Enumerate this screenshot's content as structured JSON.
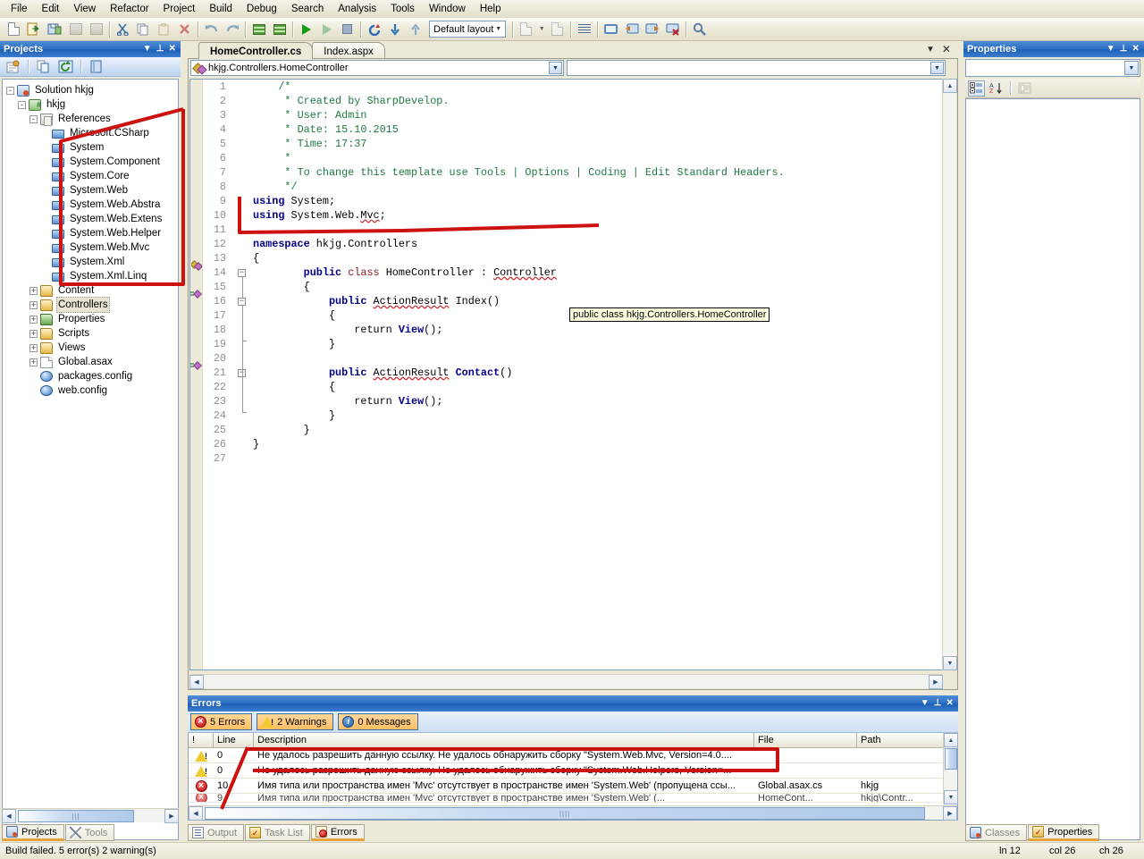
{
  "menu": {
    "items": [
      "File",
      "Edit",
      "View",
      "Refactor",
      "Project",
      "Build",
      "Debug",
      "Search",
      "Analysis",
      "Tools",
      "Window",
      "Help"
    ]
  },
  "toolbar": {
    "layout_label": "Default layout",
    "buttons": [
      "new-file-icon",
      "open-file-icon",
      "save-all-icon",
      "save-icon",
      "save-as-icon",
      "cut-icon",
      "copy-icon",
      "paste-icon",
      "delete-icon",
      "undo-icon",
      "redo-icon",
      "build-icon",
      "rebuild-icon",
      "run-icon",
      "run-debug-icon",
      "stop-icon",
      "refresh-icon",
      "step-down-icon",
      "step-up-icon"
    ],
    "right_buttons": [
      "new-form-icon",
      "dropdown-icon",
      "page-icon",
      "align-icon",
      "window-icon",
      "split-h-icon",
      "split-v-icon",
      "close-window-icon",
      "search-icon"
    ]
  },
  "projects_panel": {
    "title": "Projects",
    "title_buttons": [
      "chevron-down-icon",
      "pin-icon",
      "close-icon"
    ],
    "toolbar_buttons": [
      "properties-icon",
      "copy-icon",
      "refresh-icon",
      "view-icon"
    ],
    "tree": [
      {
        "label": "Solution hkjg",
        "icon": "solution-icon",
        "depth": 0,
        "expander": "-"
      },
      {
        "label": "hkjg",
        "icon": "csharp-project-icon",
        "depth": 1,
        "expander": "-"
      },
      {
        "label": "References",
        "icon": "references-icon",
        "depth": 2,
        "expander": "-"
      },
      {
        "label": "Microsoft.CSharp",
        "icon": "assembly-icon",
        "depth": 3,
        "expander": ""
      },
      {
        "label": "System",
        "icon": "assembly-icon",
        "depth": 3,
        "expander": ""
      },
      {
        "label": "System.Component",
        "icon": "assembly-icon",
        "depth": 3,
        "expander": ""
      },
      {
        "label": "System.Core",
        "icon": "assembly-icon",
        "depth": 3,
        "expander": ""
      },
      {
        "label": "System.Web",
        "icon": "assembly-icon",
        "depth": 3,
        "expander": ""
      },
      {
        "label": "System.Web.Abstra",
        "icon": "assembly-icon",
        "depth": 3,
        "expander": ""
      },
      {
        "label": "System.Web.Extens",
        "icon": "assembly-icon",
        "depth": 3,
        "expander": ""
      },
      {
        "label": "System.Web.Helper",
        "icon": "assembly-icon",
        "depth": 3,
        "expander": ""
      },
      {
        "label": "System.Web.Mvc",
        "icon": "assembly-icon",
        "depth": 3,
        "expander": ""
      },
      {
        "label": "System.Xml",
        "icon": "assembly-icon",
        "depth": 3,
        "expander": ""
      },
      {
        "label": "System.Xml.Linq",
        "icon": "assembly-icon",
        "depth": 3,
        "expander": ""
      },
      {
        "label": "Content",
        "icon": "folder-icon",
        "depth": 2,
        "expander": "+"
      },
      {
        "label": "Controllers",
        "icon": "folder-icon",
        "depth": 2,
        "expander": "+",
        "selected": true
      },
      {
        "label": "Properties",
        "icon": "folder-properties-icon",
        "depth": 2,
        "expander": "+"
      },
      {
        "label": "Scripts",
        "icon": "folder-icon",
        "depth": 2,
        "expander": "+"
      },
      {
        "label": "Views",
        "icon": "folder-icon",
        "depth": 2,
        "expander": "+"
      },
      {
        "label": "Global.asax",
        "icon": "asax-file-icon",
        "depth": 2,
        "expander": "+"
      },
      {
        "label": "packages.config",
        "icon": "config-file-icon",
        "depth": 2,
        "expander": ""
      },
      {
        "label": "web.config",
        "icon": "config-file-icon",
        "depth": 2,
        "expander": ""
      }
    ]
  },
  "editor": {
    "tabs": [
      {
        "label": "HomeController.cs",
        "active": true
      },
      {
        "label": "Index.aspx",
        "active": false
      }
    ],
    "tab_buttons": [
      "chevron-down-icon",
      "close-icon"
    ],
    "class_combo": "hkjg.Controllers.HomeController",
    "member_combo": "",
    "tooltip": "public class hkjg.Controllers.HomeController",
    "line_numbers": [
      "1",
      "2",
      "3",
      "4",
      "5",
      "6",
      "7",
      "8",
      "9",
      "10",
      "11",
      "12",
      "13",
      "14",
      "15",
      "16",
      "17",
      "18",
      "19",
      "20",
      "21",
      "22",
      "23",
      "24",
      "25",
      "26",
      "27"
    ],
    "code": [
      {
        "n": 1,
        "indent": 1,
        "tokens": [
          {
            "t": "/*",
            "c": "cmt"
          }
        ]
      },
      {
        "n": 2,
        "indent": 1,
        "tokens": [
          {
            "t": " * Created by SharpDevelop.",
            "c": "cmt"
          }
        ]
      },
      {
        "n": 3,
        "indent": 1,
        "tokens": [
          {
            "t": " * User: Admin",
            "c": "cmt"
          }
        ]
      },
      {
        "n": 4,
        "indent": 1,
        "tokens": [
          {
            "t": " * Date: 15.10.2015",
            "c": "cmt"
          }
        ]
      },
      {
        "n": 5,
        "indent": 1,
        "tokens": [
          {
            "t": " * Time: 17:37",
            "c": "cmt"
          }
        ]
      },
      {
        "n": 6,
        "indent": 1,
        "tokens": [
          {
            "t": " *",
            "c": "cmt"
          }
        ]
      },
      {
        "n": 7,
        "indent": 1,
        "tokens": [
          {
            "t": " * To change this template use Tools | Options | Coding | Edit Standard Headers.",
            "c": "cmt"
          }
        ]
      },
      {
        "n": 8,
        "indent": 1,
        "tokens": [
          {
            "t": " */",
            "c": "cmt"
          }
        ]
      },
      {
        "n": 9,
        "indent": 0,
        "tokens": [
          {
            "t": "using",
            "c": "kw"
          },
          {
            "t": " System;",
            "c": "plain"
          }
        ]
      },
      {
        "n": 10,
        "indent": 0,
        "tokens": [
          {
            "t": "using",
            "c": "kw"
          },
          {
            "t": " System.Web.",
            "c": "plain"
          },
          {
            "t": "Mvc",
            "c": "sq"
          },
          {
            "t": ";",
            "c": "plain"
          }
        ]
      },
      {
        "n": 11,
        "indent": 0,
        "tokens": []
      },
      {
        "n": 12,
        "indent": 0,
        "tokens": [
          {
            "t": "namespace",
            "c": "kw"
          },
          {
            "t": " hkjg.Controllers",
            "c": "plain"
          }
        ]
      },
      {
        "n": 13,
        "indent": 0,
        "tokens": [
          {
            "t": "{",
            "c": "plain"
          }
        ]
      },
      {
        "n": 14,
        "indent": 2,
        "tokens": [
          {
            "t": "public",
            "c": "kw"
          },
          {
            "t": " ",
            "c": "plain"
          },
          {
            "t": "class",
            "c": "type"
          },
          {
            "t": " HomeController : ",
            "c": "plain"
          },
          {
            "t": "Controller",
            "c": "sq"
          }
        ]
      },
      {
        "n": 15,
        "indent": 2,
        "tokens": [
          {
            "t": "{",
            "c": "plain"
          }
        ]
      },
      {
        "n": 16,
        "indent": 3,
        "tokens": [
          {
            "t": "public",
            "c": "kw"
          },
          {
            "t": " ",
            "c": "plain"
          },
          {
            "t": "ActionResult",
            "c": "sq"
          },
          {
            "t": " Index()",
            "c": "plain"
          }
        ]
      },
      {
        "n": 17,
        "indent": 3,
        "tokens": [
          {
            "t": "{",
            "c": "plain"
          }
        ]
      },
      {
        "n": 18,
        "indent": 4,
        "tokens": [
          {
            "t": "return ",
            "c": "plain"
          },
          {
            "t": "View",
            "c": "kw"
          },
          {
            "t": "();",
            "c": "plain"
          }
        ]
      },
      {
        "n": 19,
        "indent": 3,
        "tokens": [
          {
            "t": "}",
            "c": "plain"
          }
        ]
      },
      {
        "n": 20,
        "indent": 0,
        "tokens": []
      },
      {
        "n": 21,
        "indent": 3,
        "tokens": [
          {
            "t": "public",
            "c": "kw"
          },
          {
            "t": " ",
            "c": "plain"
          },
          {
            "t": "ActionResult",
            "c": "sq"
          },
          {
            "t": " ",
            "c": "plain"
          },
          {
            "t": "Contact",
            "c": "kw"
          },
          {
            "t": "()",
            "c": "plain"
          }
        ]
      },
      {
        "n": 22,
        "indent": 3,
        "tokens": [
          {
            "t": "{",
            "c": "plain"
          }
        ]
      },
      {
        "n": 23,
        "indent": 4,
        "tokens": [
          {
            "t": "return ",
            "c": "plain"
          },
          {
            "t": "View",
            "c": "kw"
          },
          {
            "t": "();",
            "c": "plain"
          }
        ]
      },
      {
        "n": 24,
        "indent": 3,
        "tokens": [
          {
            "t": "}",
            "c": "plain"
          }
        ]
      },
      {
        "n": 25,
        "indent": 2,
        "tokens": [
          {
            "t": "}",
            "c": "plain"
          }
        ]
      },
      {
        "n": 26,
        "indent": 0,
        "tokens": [
          {
            "t": "}",
            "c": "plain"
          }
        ]
      },
      {
        "n": 27,
        "indent": 0,
        "tokens": []
      }
    ]
  },
  "errors_panel": {
    "title": "Errors",
    "title_buttons": [
      "chevron-down-icon",
      "pin-icon",
      "close-icon"
    ],
    "filters": [
      {
        "icon": "error-icon",
        "label": "5 Errors"
      },
      {
        "icon": "warning-icon",
        "label": "2 Warnings"
      },
      {
        "icon": "info-icon",
        "label": "0 Messages"
      }
    ],
    "columns": [
      "!",
      "Line",
      "Description",
      "File",
      "Path"
    ],
    "rows": [
      {
        "severity": "warning-icon",
        "line": "0",
        "description": "Не удалось разрешить данную ссылку. Не удалось обнаружить сборку \"System.Web.Mvc, Version=4.0....",
        "file": "",
        "path": ""
      },
      {
        "severity": "warning-icon",
        "line": "0",
        "description": "Не удалось разрешить данную ссылку. Не удалось обнаружить сборку \"System.Web.Helpers, Version=...",
        "file": "",
        "path": ""
      },
      {
        "severity": "error-icon",
        "line": "10",
        "description": "Имя типа или пространства имен 'Mvc' отсутствует в пространстве имен 'System.Web' (пропущена ссы...",
        "file": "Global.asax.cs",
        "path": "hkjg"
      }
    ]
  },
  "properties_panel": {
    "title": "Properties",
    "title_buttons": [
      "chevron-down-icon",
      "pin-icon",
      "close-icon"
    ],
    "object_combo": "",
    "toolbar_buttons": [
      "categorized-icon",
      "alphabetical-icon",
      "property-pages-icon"
    ]
  },
  "left_bottom_tabs": [
    {
      "label": "Projects",
      "icon": "projects-icon",
      "active": true
    },
    {
      "label": "Tools",
      "icon": "tools-icon",
      "active": false
    }
  ],
  "pad_bottom_tabs": [
    {
      "label": "Output",
      "icon": "output-icon",
      "active": false
    },
    {
      "label": "Task List",
      "icon": "task-list-icon",
      "active": false
    },
    {
      "label": "Errors",
      "icon": "errors-icon",
      "active": true
    }
  ],
  "right_bottom_tabs": [
    {
      "label": "Classes",
      "icon": "classes-icon",
      "active": false
    },
    {
      "label": "Properties",
      "icon": "properties-icon",
      "active": true
    }
  ],
  "status_bar": {
    "message": "Build failed. 5 error(s) 2 warning(s)",
    "line": "ln 12",
    "col": "col 26",
    "ch": "ch 26"
  },
  "colors": {
    "title_blue": "#2c6fc4",
    "panel_bg": "#ece9d8",
    "annotation_red": "#cc1111",
    "comment_green": "#1f7a3d",
    "keyword_blue": "#00008b",
    "type_red": "#8b1a1a",
    "filter_orange": "#fcbf63"
  }
}
